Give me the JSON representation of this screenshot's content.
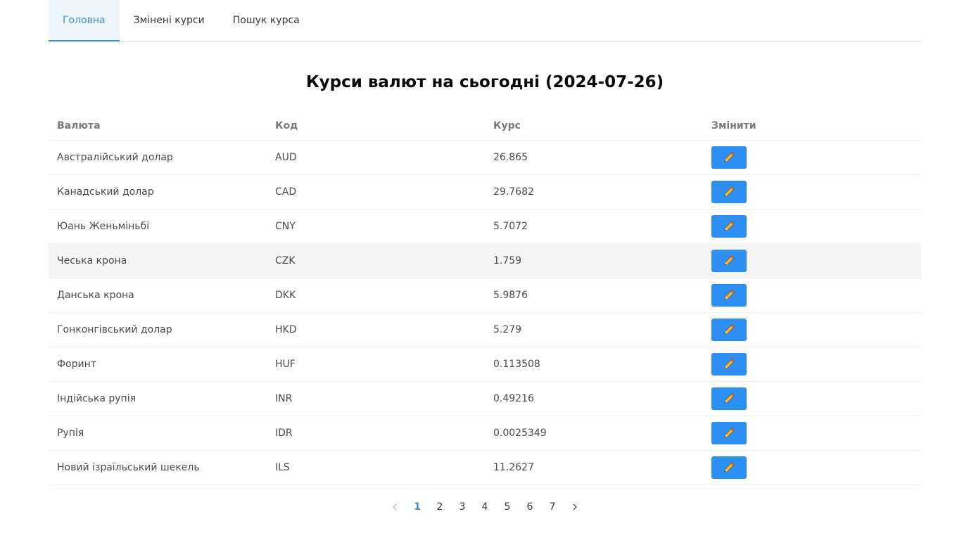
{
  "tabs": [
    {
      "label": "Головна",
      "active": true
    },
    {
      "label": "Змінені курси",
      "active": false
    },
    {
      "label": "Пошук курса",
      "active": false
    }
  ],
  "title": "Курси валют на сьогодні (2024-07-26)",
  "table": {
    "headers": [
      "Валюта",
      "Код",
      "Курс",
      "Змінити"
    ],
    "rows": [
      {
        "currency": "Австралійський долар",
        "code": "AUD",
        "rate": "26.865"
      },
      {
        "currency": "Канадський долар",
        "code": "CAD",
        "rate": "29.7682"
      },
      {
        "currency": "Юань Женьміньбі",
        "code": "CNY",
        "rate": "5.7072"
      },
      {
        "currency": "Чеська крона",
        "code": "CZK",
        "rate": "1.759"
      },
      {
        "currency": "Данська крона",
        "code": "DKK",
        "rate": "5.9876"
      },
      {
        "currency": "Гонконгівський долар",
        "code": "HKD",
        "rate": "5.279"
      },
      {
        "currency": "Форинт",
        "code": "HUF",
        "rate": "0.113508"
      },
      {
        "currency": "Індійська рупія",
        "code": "INR",
        "rate": "0.49216"
      },
      {
        "currency": "Рупія",
        "code": "IDR",
        "rate": "0.0025349"
      },
      {
        "currency": "Новий ізраїльський шекель",
        "code": "ILS",
        "rate": "11.2627"
      }
    ],
    "highlighted_row": 3,
    "edit_icon": "pencil-icon"
  },
  "pagination": {
    "pages": [
      "1",
      "2",
      "3",
      "4",
      "5",
      "6",
      "7"
    ],
    "current": "1",
    "prev_icon": "chevron-left-icon",
    "next_icon": "chevron-right-icon"
  },
  "colors": {
    "accent": "#3e8ed0",
    "button": "#2e8ff2",
    "tab_active_bg": "#eef6fc"
  }
}
